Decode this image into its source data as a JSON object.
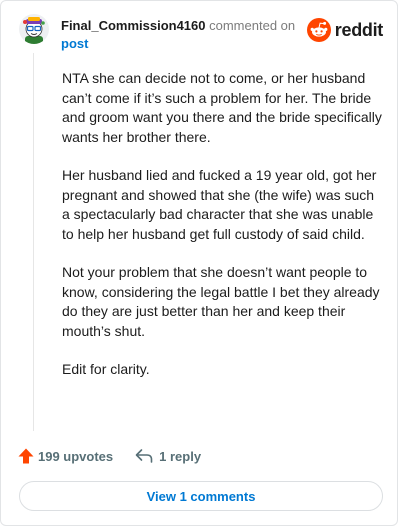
{
  "header": {
    "username": "Final_Commission4160",
    "action_text": "commented on",
    "post_link": "post",
    "brand": "reddit"
  },
  "comment": {
    "paragraphs": [
      "NTA she can decide not to come, or her husband can’t come if it’s such a problem for her. The bride and groom want you there and the bride specifically wants her brother there.",
      "Her husband lied and fucked a 19 year old, got her pregnant and showed that she (the wife) was such a spectacularly bad character that she was unable to help her husband get full custody of said child.",
      "Not your problem that she doesn’t want people to know, considering the legal battle I bet they already do they are just better than her and keep their mouth’s shut.",
      "Edit for clarity."
    ]
  },
  "actions": {
    "upvotes_label": "199 upvotes",
    "reply_label": "1 reply",
    "view_comments_label": "View 1 comments"
  },
  "colors": {
    "reddit_orange": "#ff4500",
    "link_blue": "#0079d3",
    "upvote_red": "#ff4500",
    "meta_gray": "#576f76"
  },
  "icons": {
    "avatar": "snoo-avatar-icon",
    "brand": "reddit-logo-icon",
    "upvote": "upvote-arrow-icon",
    "reply": "reply-arrow-icon"
  }
}
